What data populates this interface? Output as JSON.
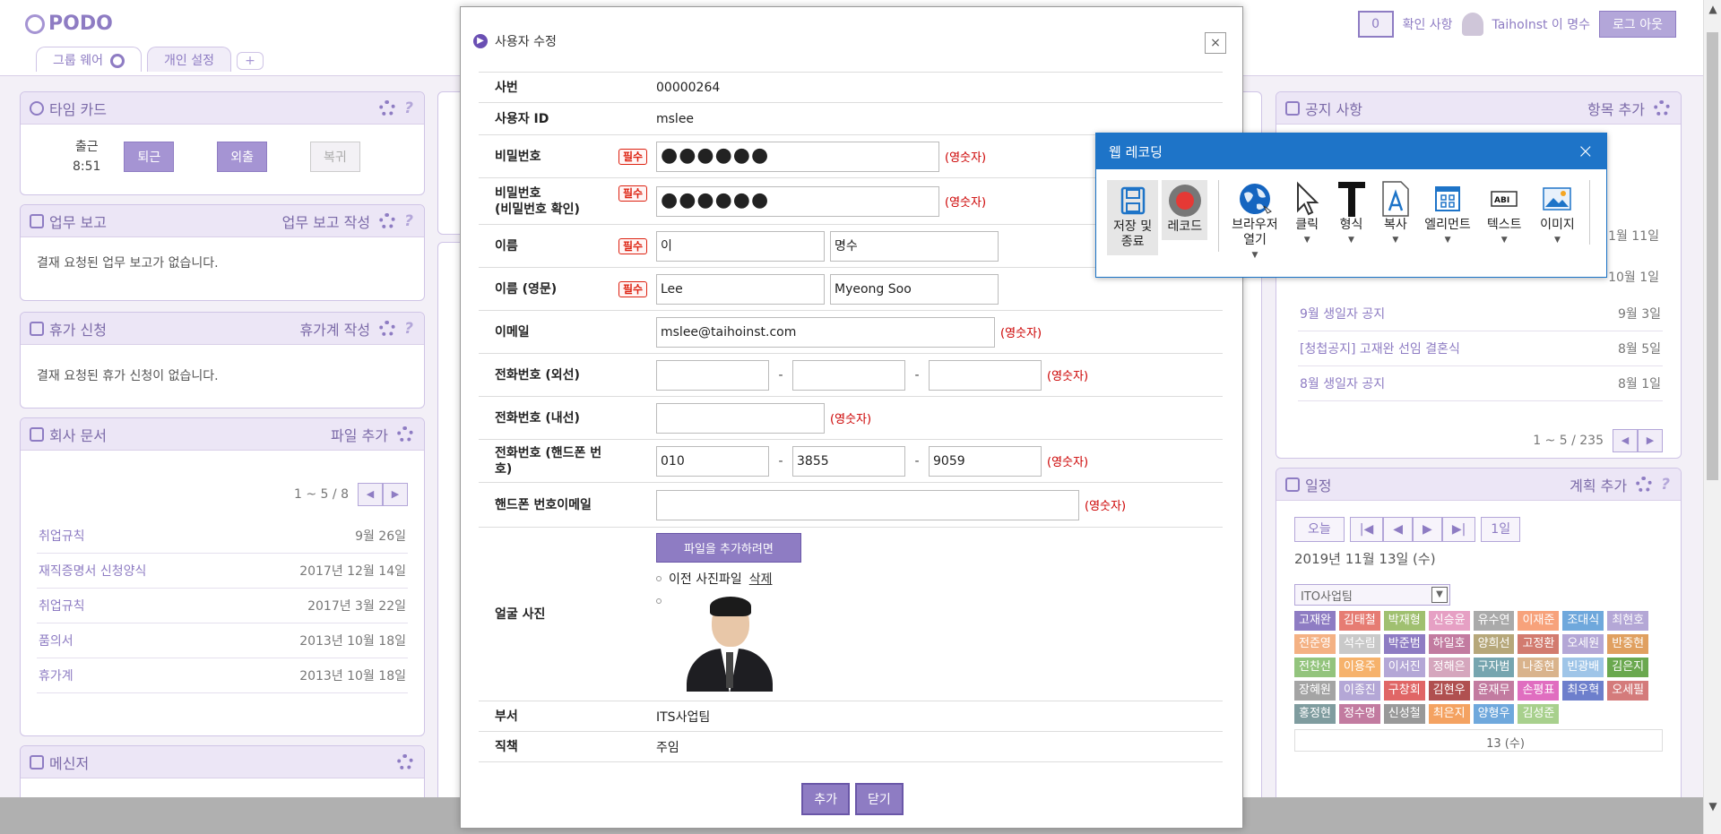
{
  "portal": {
    "logo": "PODO",
    "tabs": [
      "그룹 웨어",
      "개인 설정"
    ],
    "tab_add": "+",
    "notification_count": "0",
    "notification_label": "확인 사항",
    "user_name": "TaihoInst 이 명수",
    "logout_label": "로그 아웃"
  },
  "timecard": {
    "title": "타임 카드",
    "checkin_label": "출근",
    "checkin_time": "8:51",
    "buttons": [
      "퇴근",
      "외출",
      "복귀"
    ]
  },
  "work_report": {
    "title": "업무 보고",
    "action": "업무 보고 작성",
    "empty": "결재 요청된 업무 보고가 없습니다."
  },
  "leave": {
    "title": "휴가 신청",
    "action": "휴가계 작성",
    "empty": "결재 요청된 휴가 신청이 없습니다."
  },
  "documents": {
    "title": "회사 문서",
    "action": "파일 추가",
    "pager": "1 ~ 5 / 8",
    "items": [
      {
        "title": "취업규칙",
        "date": "9월 26일"
      },
      {
        "title": "재직증명서 신청양식",
        "date": "2017년 12월 14일"
      },
      {
        "title": "취업규칙",
        "date": "2017년 3월 22일"
      },
      {
        "title": "품의서",
        "date": "2013년 10월 18일"
      },
      {
        "title": "휴가계",
        "date": "2013년 10월 18일"
      }
    ]
  },
  "messenger": {
    "title": "메신저"
  },
  "notice": {
    "title": "공지 사항",
    "action": "항목 추가",
    "pager": "1 ~ 5 / 235",
    "partial_dates": [
      "1월 11일",
      "10월 1일"
    ],
    "items": [
      {
        "title": "9월 생일자 공지",
        "date": "9월 3일"
      },
      {
        "title": "[청첩공지] 고재완 선임 결혼식",
        "date": "8월 5일"
      },
      {
        "title": "8월 생일자 공지",
        "date": "8월 1일"
      }
    ]
  },
  "schedule": {
    "title": "일정",
    "action": "계획 추가",
    "today": "오늘",
    "nav": [
      "|◀",
      "◀",
      "▶",
      "▶|"
    ],
    "range": "1일",
    "date": "2019년 11월 13일 (수)",
    "dept": "ITO사업팀",
    "members": [
      "고재완",
      "김태철",
      "박재형",
      "신승윤",
      "유수연",
      "이재준",
      "조대식",
      "최현호",
      "전준영",
      "석수림",
      "박준범",
      "하일호",
      "양희선",
      "고정환",
      "오세원",
      "반중현",
      "전찬선",
      "이용주",
      "이서진",
      "정해은",
      "구자범",
      "나종현",
      "빈광배",
      "김은지",
      "장혜원",
      "이종진",
      "구창회",
      "김현우",
      "윤재무",
      "손평표",
      "최우혁",
      "오세필",
      "홍정현",
      "정수명",
      "신성철",
      "최은지",
      "양형우",
      "김성준"
    ],
    "member_colors": [
      "#8e7cc3",
      "#e67c73",
      "#a0c070",
      "#e6a0c4",
      "#aaaaaa",
      "#f7a27b",
      "#6fa8dc",
      "#b4a7d6",
      "#f4b183",
      "#c9c9c9",
      "#8e7cc3",
      "#c27ba0",
      "#b6a77a",
      "#d27b6f",
      "#b4a7d6",
      "#e0a060",
      "#93c47d",
      "#f6b26b",
      "#b4a7d6",
      "#d5a6bd",
      "#76a5af",
      "#d9b38c",
      "#9fc5e8",
      "#6aa84f",
      "#a4a4a4",
      "#b4a7d6",
      "#e06666",
      "#b05050",
      "#c27ba0",
      "#e06ec0",
      "#6d7fcc",
      "#d47b7b",
      "#7f9c9f",
      "#c27ba0",
      "#999999",
      "#f4a261",
      "#6fa8dc",
      "#a8d08d"
    ],
    "day_header": "13 (수)"
  },
  "modal": {
    "title": "사용자 수정",
    "close": "×",
    "required": "필수",
    "fields": {
      "emp_no": {
        "label": "사번",
        "value": "00000264"
      },
      "user_id": {
        "label": "사용자 ID",
        "value": "mslee"
      },
      "password": {
        "label": "비밀번호",
        "value": "●●●●●●",
        "hint": "(영숫자)"
      },
      "password_confirm": {
        "label": "비밀번호",
        "label2": "(비밀번호 확인)",
        "value": "●●●●●●",
        "hint": "(영숫자)"
      },
      "name": {
        "label": "이름",
        "last": "이",
        "first": "명수"
      },
      "name_en": {
        "label": "이름 (영문)",
        "last": "Lee",
        "first": "Myeong Soo"
      },
      "email": {
        "label": "이메일",
        "value": "mslee@taihoinst.com",
        "hint": "(영숫자)"
      },
      "phone_ext": {
        "label": "전화번호 (외선)",
        "parts": [
          "",
          "",
          ""
        ],
        "hint": "(영숫자)"
      },
      "phone_int": {
        "label": "전화번호 (내선)",
        "value": "",
        "hint": "(영숫자)"
      },
      "phone_mobile": {
        "label": "전화번호 (핸드폰 번호)",
        "parts": [
          "010",
          "3855",
          "9059"
        ],
        "hint": "(영숫자)"
      },
      "mobile_email": {
        "label": "핸드폰 번호이메일",
        "value": "",
        "hint": "(영숫자)"
      },
      "photo": {
        "label": "얼굴 사진",
        "add_button": "파일을 추가하려면",
        "prev_file": "이전 사진파일",
        "delete": "삭제"
      },
      "dept": {
        "label": "부서",
        "value": "ITS사업팀"
      },
      "position": {
        "label": "직책",
        "value": "주임"
      }
    },
    "add_button": "추가",
    "close_button": "닫기"
  },
  "recorder": {
    "title": "웹 레코딩",
    "close": "×",
    "tools": {
      "save_stop": [
        "저장 및",
        "종료"
      ],
      "record": "레코드",
      "open_browser": [
        "브라우저",
        "열기"
      ],
      "click": "클릭",
      "type": "형식",
      "copy": "복사",
      "element": "엘리먼트",
      "text": "텍스트",
      "image": "이미지"
    }
  }
}
